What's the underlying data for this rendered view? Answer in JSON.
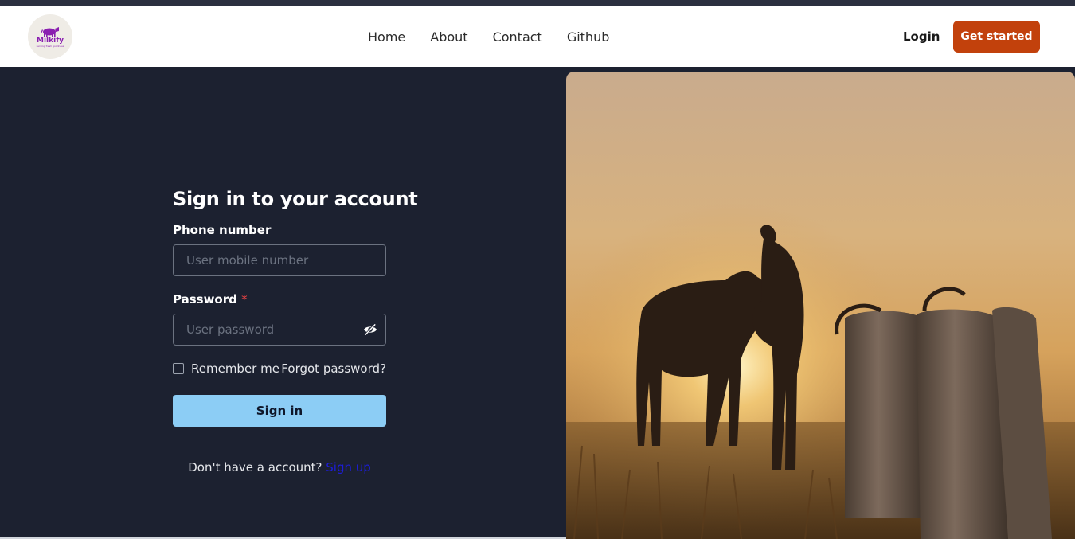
{
  "brand": {
    "logo_text": "Milkify",
    "logo_tagline": "serving fresh goodness"
  },
  "nav": {
    "links": [
      "Home",
      "About",
      "Contact",
      "Github"
    ],
    "login_label": "Login",
    "cta_label": "Get started",
    "cta_color": "#c2410c"
  },
  "form": {
    "title": "Sign in to your account",
    "phone_label": "Phone number",
    "phone_placeholder": "User mobile number",
    "password_label": "Password",
    "password_required_mark": "*",
    "password_placeholder": "User password",
    "remember_label": "Remember me",
    "forgot_label": "Forgot password?",
    "submit_label": "Sign in",
    "submit_color": "#8ccdf5",
    "no_account_text": "Don't have a account?",
    "signup_label": "Sign up"
  },
  "icons": {
    "logo": "cow-logo-icon",
    "password_toggle": "eye-slash-icon"
  },
  "hero_image": {
    "subject": "silhouette-farmer-cow-milk-cans-sunset"
  }
}
